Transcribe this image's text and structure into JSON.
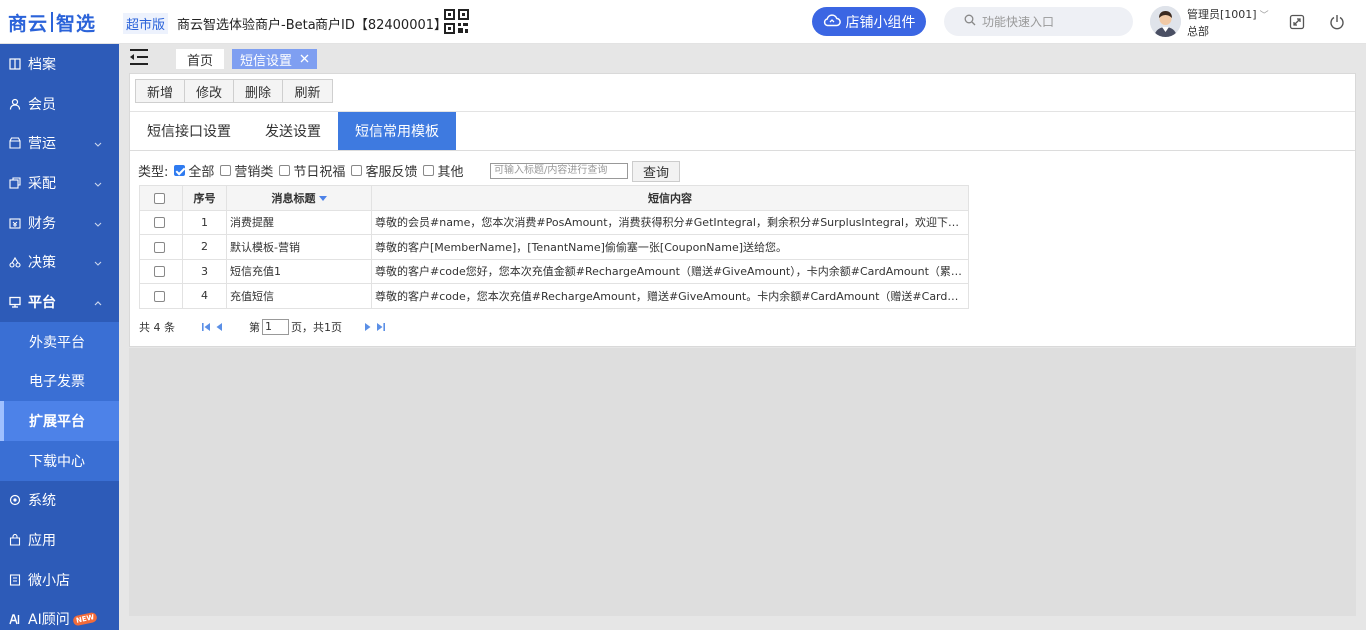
{
  "header": {
    "logo_left": "商云",
    "logo_right": "智选",
    "edition": "超市版",
    "merchant_name": "商云智选体验商户-Beta",
    "merchant_id": "商户ID【82400001】",
    "widget_button": "店铺小组件",
    "search_placeholder": "功能快速入口",
    "user_name": "管理员[1001]",
    "user_dept": "总部"
  },
  "sidebar": {
    "items": [
      {
        "label": "档案"
      },
      {
        "label": "会员"
      },
      {
        "label": "营运"
      },
      {
        "label": "采配"
      },
      {
        "label": "财务"
      },
      {
        "label": "决策"
      },
      {
        "label": "平台"
      },
      {
        "label": "系统"
      },
      {
        "label": "应用"
      },
      {
        "label": "微小店"
      },
      {
        "label": "AI顾问"
      }
    ],
    "sub_items": [
      {
        "label": "外卖平台"
      },
      {
        "label": "电子发票"
      },
      {
        "label": "扩展平台"
      },
      {
        "label": "下载中心"
      }
    ],
    "new_badge": "NEW"
  },
  "tabstrip": {
    "home": "首页",
    "current": "短信设置"
  },
  "toolbar": {
    "add": "新增",
    "edit": "修改",
    "delete": "删除",
    "refresh": "刷新"
  },
  "tabs": {
    "interface": "短信接口设置",
    "send": "发送设置",
    "templates": "短信常用模板"
  },
  "filter": {
    "type_label": "类型:",
    "options": [
      "全部",
      "营销类",
      "节日祝福",
      "客服反馈",
      "其他"
    ],
    "query_placeholder": "可输入标题/内容进行查询",
    "query_button": "查询"
  },
  "table": {
    "headers": [
      "序号",
      "消息标题",
      "短信内容"
    ],
    "rows": [
      {
        "no": "1",
        "title": "消费提醒",
        "content": "尊敬的会员#name，您本次消费#PosAmount，消费获得积分#GetIntegral，剩余积分#SurplusIntegral，欢迎下次光临！"
      },
      {
        "no": "2",
        "title": "默认模板-营销",
        "content": "尊敬的客户[MemberName]，[TenantName]偷偷塞一张[CouponName]送给您。"
      },
      {
        "no": "3",
        "title": "短信充值1",
        "content": "尊敬的客户#code您好，您本次充值金额#RechargeAmount（赠送#GiveAmount），卡内余额#CardAmount（累计赠..."
      },
      {
        "no": "4",
        "title": "充值短信",
        "content": "尊敬的客户#code，您本次充值#RechargeAmount，赠送#GiveAmount。卡内余额#CardAmount（赠送#CardGiveAm..."
      }
    ]
  },
  "pager": {
    "total": "共 4 条",
    "page_prefix": "第",
    "page_value": "1",
    "page_suffix": "页，共1页"
  },
  "colors": {
    "brand": "#2b63d9",
    "sidebar": "#2d5bb8",
    "active_tab": "#3e7ae0"
  }
}
